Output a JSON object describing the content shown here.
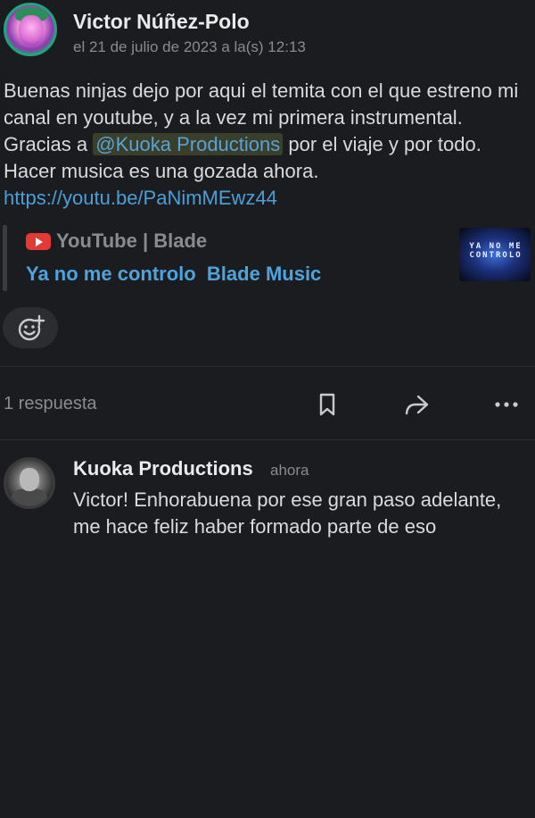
{
  "post": {
    "author": "Victor Núñez-Polo",
    "timestamp": "el 21 de julio de 2023 a la(s) 12:13",
    "text_before_mention": "Buenas ninjas dejo por aqui el temita con el que estreno mi canal en youtube, y a la vez mi primera instrumental. Gracias a ",
    "mention": "@Kuoka Productions",
    "text_after_mention": "  por el viaje y por todo. Hacer musica es una gozada ahora. ",
    "link": "https://youtu.be/PaNimMEwz44"
  },
  "attachment": {
    "icon": "youtube-icon",
    "source": "YouTube | Blade",
    "title": "Ya no me controlo  Blade Music",
    "thumbnail_text": "YA NO ME CONTROLO"
  },
  "reaction": {
    "icon": "add-reaction-icon"
  },
  "actions": {
    "reply_count": "1 respuesta",
    "icons": [
      "bookmark-icon",
      "share-icon",
      "more-icon"
    ]
  },
  "reply": {
    "author": "Kuoka Productions",
    "time": "ahora",
    "text": "Victor! Enhorabuena por ese gran paso adelante, me hace feliz haber formado parte de eso"
  },
  "colors": {
    "background": "#1b1c20",
    "link": "#4a9fd8",
    "mention_bg": "#3a3f2c",
    "muted": "#8a8b8f"
  }
}
